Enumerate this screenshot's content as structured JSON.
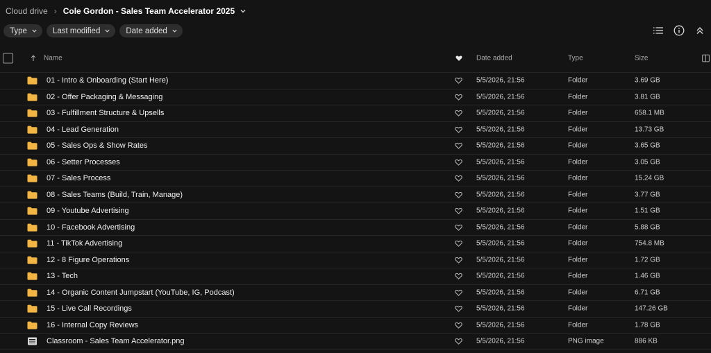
{
  "breadcrumb": {
    "root": "Cloud drive",
    "current": "Cole Gordon - Sales Team Accelerator 2025"
  },
  "filters": [
    {
      "label": "Type"
    },
    {
      "label": "Last modified"
    },
    {
      "label": "Date added"
    }
  ],
  "columns": {
    "name": "Name",
    "date_added": "Date added",
    "type": "Type",
    "size": "Size"
  },
  "colors": {
    "folder": "#f2b544",
    "background": "#141414",
    "chip": "#2e2e2e"
  },
  "rows": [
    {
      "icon": "folder-icon",
      "name": "01 - Intro & Onboarding (Start Here)",
      "date": "5/5/2026, 21:56",
      "type": "Folder",
      "size": "3.69 GB"
    },
    {
      "icon": "folder-icon",
      "name": "02 - Offer Packaging & Messaging",
      "date": "5/5/2026, 21:56",
      "type": "Folder",
      "size": "3.81 GB"
    },
    {
      "icon": "folder-icon",
      "name": "03 - Fulfillment Structure & Upsells",
      "date": "5/5/2026, 21:56",
      "type": "Folder",
      "size": "658.1 MB"
    },
    {
      "icon": "folder-icon",
      "name": "04 - Lead Generation",
      "date": "5/5/2026, 21:56",
      "type": "Folder",
      "size": "13.73 GB"
    },
    {
      "icon": "folder-icon",
      "name": "05 - Sales Ops & Show Rates",
      "date": "5/5/2026, 21:56",
      "type": "Folder",
      "size": "3.65 GB"
    },
    {
      "icon": "folder-icon",
      "name": "06 - Setter Processes",
      "date": "5/5/2026, 21:56",
      "type": "Folder",
      "size": "3.05 GB"
    },
    {
      "icon": "folder-icon",
      "name": "07 - Sales Process",
      "date": "5/5/2026, 21:56",
      "type": "Folder",
      "size": "15.24 GB"
    },
    {
      "icon": "folder-icon",
      "name": "08 - Sales Teams (Build, Train, Manage)",
      "date": "5/5/2026, 21:56",
      "type": "Folder",
      "size": "3.77 GB"
    },
    {
      "icon": "folder-icon",
      "name": "09 - Youtube Advertising",
      "date": "5/5/2026, 21:56",
      "type": "Folder",
      "size": "1.51 GB"
    },
    {
      "icon": "folder-icon",
      "name": "10 - Facebook Advertising",
      "date": "5/5/2026, 21:56",
      "type": "Folder",
      "size": "5.88 GB"
    },
    {
      "icon": "folder-icon",
      "name": "11 - TikTok Advertising",
      "date": "5/5/2026, 21:56",
      "type": "Folder",
      "size": "754.8 MB"
    },
    {
      "icon": "folder-icon",
      "name": "12 - 8 Figure Operations",
      "date": "5/5/2026, 21:56",
      "type": "Folder",
      "size": "1.72 GB"
    },
    {
      "icon": "folder-icon",
      "name": "13 - Tech",
      "date": "5/5/2026, 21:56",
      "type": "Folder",
      "size": "1.46 GB"
    },
    {
      "icon": "folder-icon",
      "name": "14 - Organic Content Jumpstart (YouTube, IG, Podcast)",
      "date": "5/5/2026, 21:56",
      "type": "Folder",
      "size": "6.71 GB"
    },
    {
      "icon": "folder-icon",
      "name": "15 - Live Call Recordings",
      "date": "5/5/2026, 21:56",
      "type": "Folder",
      "size": "147.26 GB"
    },
    {
      "icon": "folder-icon",
      "name": "16 - Internal Copy Reviews",
      "date": "5/5/2026, 21:56",
      "type": "Folder",
      "size": "1.78 GB"
    },
    {
      "icon": "image-file-icon",
      "name": "Classroom - Sales Team Accelerator.png",
      "date": "5/5/2026, 21:56",
      "type": "PNG image",
      "size": "886 KB"
    }
  ]
}
